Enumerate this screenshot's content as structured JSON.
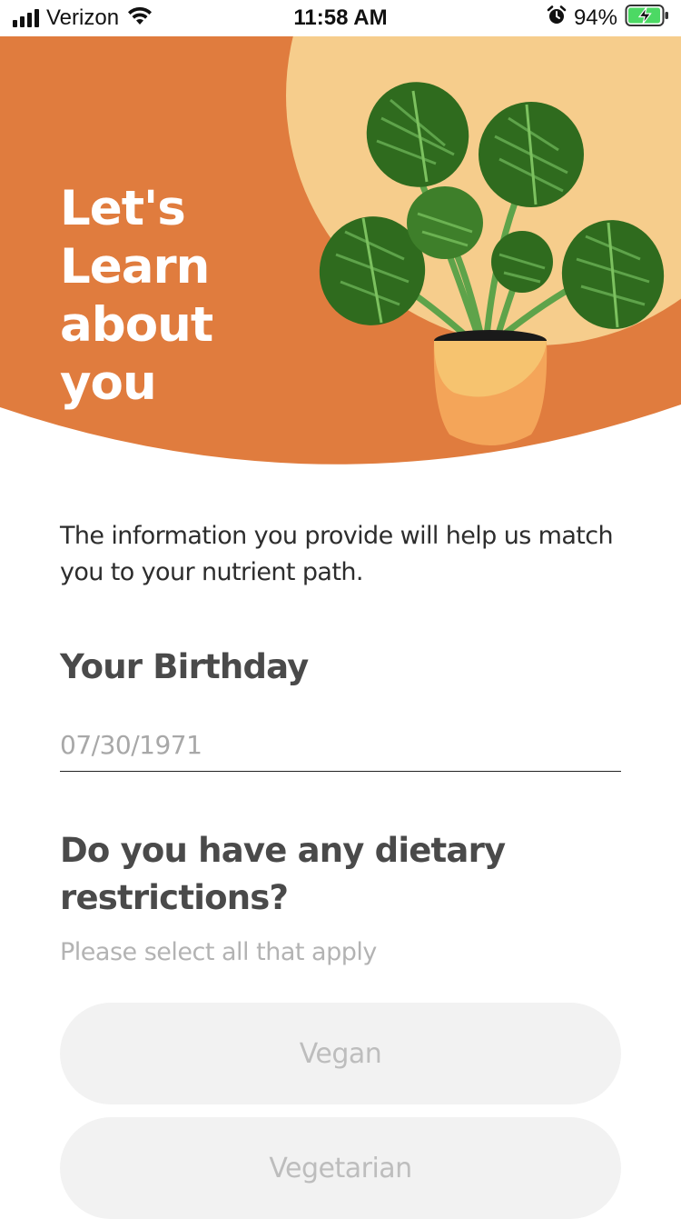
{
  "status_bar": {
    "carrier": "Verizon",
    "time": "11:58 AM",
    "battery_percent": "94%",
    "icons": [
      "signal-icon",
      "wifi-icon",
      "alarm-icon",
      "battery-charging-icon"
    ]
  },
  "hero": {
    "title_line1": "Let's Learn",
    "title_line2": "about you",
    "illustration": "monstera-plant-in-pot",
    "colors": {
      "background": "#e07c3e",
      "sun": "#f6cd8c",
      "leaf_dark": "#2f6b1e",
      "leaf_light": "#5ea34a",
      "pot": "#f4a559"
    }
  },
  "intro": {
    "text": "The information you provide will help us match you to your nutrient path."
  },
  "birthday": {
    "label": "Your Birthday",
    "placeholder": "07/30/1971"
  },
  "dietary": {
    "question": "Do you have any dietary restrictions?",
    "hint": "Please select all that apply",
    "options": [
      {
        "label": "Vegan"
      },
      {
        "label": "Vegetarian"
      }
    ]
  }
}
